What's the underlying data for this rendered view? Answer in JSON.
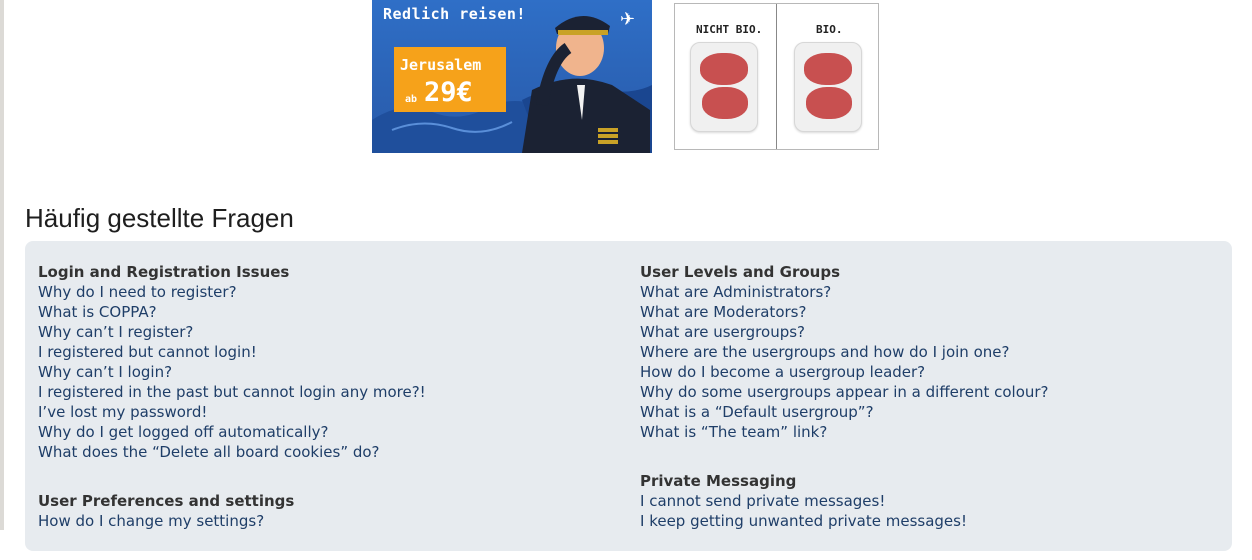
{
  "banner": {
    "slogan": "Redlich reisen!",
    "destination": "Jerusalem",
    "price_prefix": "ab",
    "price": "29€",
    "plane_glyph": "✈",
    "icon": "airplane-icon",
    "colors": {
      "sky": "#2f6fc7",
      "offer": "#f6a21a"
    }
  },
  "bio_ad": {
    "left_label": "NICHT BIO.",
    "right_label": "BIO."
  },
  "page_title": "Häufig gestellte Fragen",
  "faq": {
    "left": [
      {
        "heading": "Login and Registration Issues",
        "links": [
          "Why do I need to register?",
          "What is COPPA?",
          "Why can’t I register?",
          "I registered but cannot login!",
          "Why can’t I login?",
          "I registered in the past but cannot login any more?!",
          "I’ve lost my password!",
          "Why do I get logged off automatically?",
          "What does the “Delete all board cookies” do?"
        ]
      },
      {
        "heading": "User Preferences and settings",
        "links": [
          "How do I change my settings?"
        ]
      }
    ],
    "right": [
      {
        "heading": "User Levels and Groups",
        "links": [
          "What are Administrators?",
          "What are Moderators?",
          "What are usergroups?",
          "Where are the usergroups and how do I join one?",
          "How do I become a usergroup leader?",
          "Why do some usergroups appear in a different colour?",
          "What is a “Default usergroup”?",
          "What is “The team” link?"
        ]
      },
      {
        "heading": "Private Messaging",
        "links": [
          "I cannot send private messages!",
          "I keep getting unwanted private messages!"
        ]
      }
    ]
  },
  "colors": {
    "link": "#1f3e68",
    "heading": "#333333",
    "panel_bg": "#e7ebef"
  }
}
